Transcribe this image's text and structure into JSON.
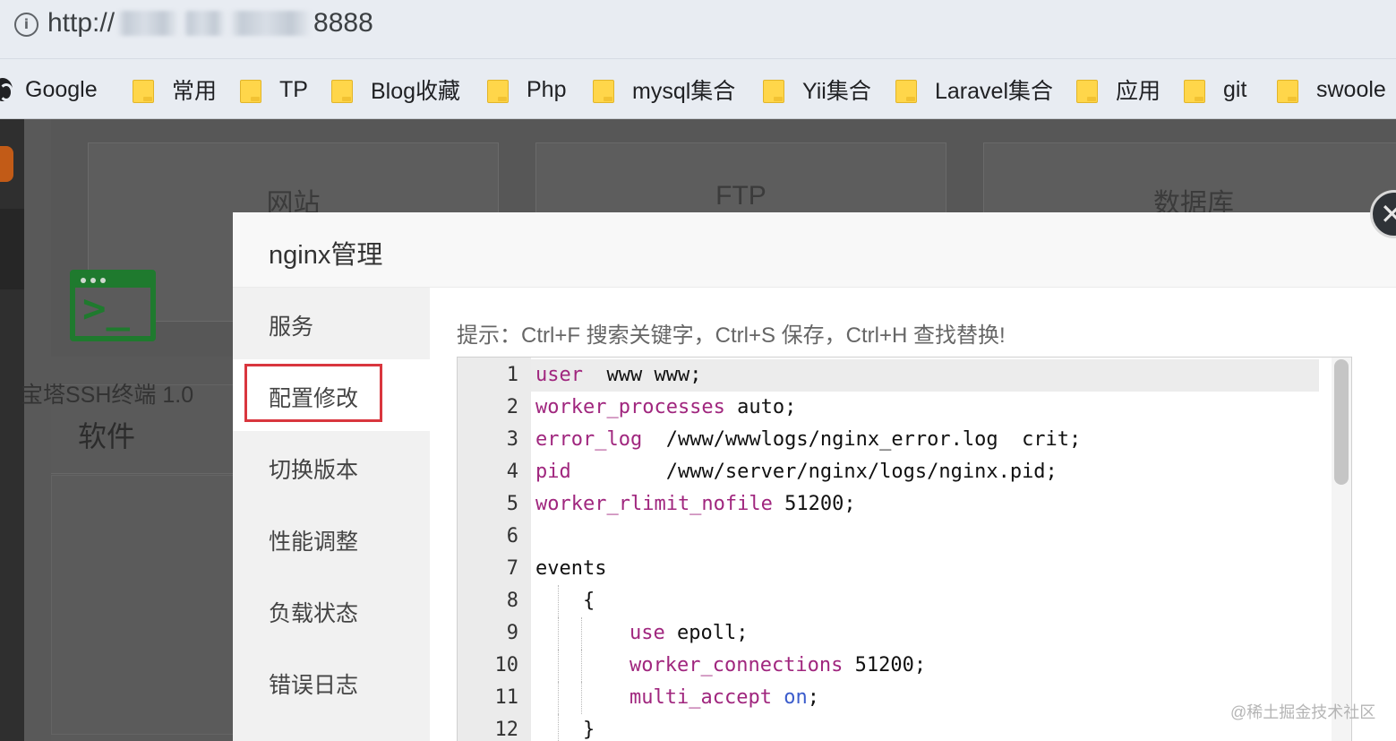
{
  "browser": {
    "url_prefix": "http://",
    "url_suffix": "8888",
    "bookmarks": [
      {
        "label": "Google",
        "icon": "google-icon"
      },
      {
        "label": "常用",
        "icon": "folder-icon"
      },
      {
        "label": "TP",
        "icon": "folder-icon"
      },
      {
        "label": "Blog收藏",
        "icon": "folder-icon"
      },
      {
        "label": "Php",
        "icon": "folder-icon"
      },
      {
        "label": "mysql集合",
        "icon": "folder-icon"
      },
      {
        "label": "Yii集合",
        "icon": "folder-icon"
      },
      {
        "label": "Laravel集合",
        "icon": "folder-icon"
      },
      {
        "label": "应用",
        "icon": "folder-icon"
      },
      {
        "label": "git",
        "icon": "folder-icon"
      },
      {
        "label": "swoole",
        "icon": "folder-icon"
      }
    ]
  },
  "background": {
    "stats": [
      "网站",
      "FTP",
      "数据库"
    ],
    "software_title": "软件",
    "ssh_label": "宝塔SSH终端 1.0"
  },
  "modal": {
    "title": "nginx管理",
    "nav": [
      "服务",
      "配置修改",
      "切换版本",
      "性能调整",
      "负载状态",
      "错误日志"
    ],
    "active_nav": "配置修改",
    "hint": "提示：Ctrl+F 搜索关键字，Ctrl+S 保存，Ctrl+H 查找替换!",
    "code_lines": [
      {
        "n": "1",
        "key": "user",
        "rest": "  www www;"
      },
      {
        "n": "2",
        "key": "worker_processes",
        "rest": " auto;"
      },
      {
        "n": "3",
        "key": "error_log",
        "rest": "  /www/wwwlogs/nginx_error.log  crit;"
      },
      {
        "n": "4",
        "key": "pid",
        "rest": "        /www/server/nginx/logs/nginx.pid;"
      },
      {
        "n": "5",
        "key": "worker_rlimit_nofile",
        "rest": " 51200;"
      },
      {
        "n": "6",
        "key": "",
        "rest": ""
      },
      {
        "n": "7",
        "key": "",
        "rest": "events"
      },
      {
        "n": "8",
        "key": "",
        "rest": "    {"
      },
      {
        "n": "9",
        "key": "use",
        "rest": " epoll;"
      },
      {
        "n": "10",
        "key": "worker_connections",
        "rest": " 51200;"
      },
      {
        "n": "11",
        "key": "multi_accept",
        "rest": " ",
        "value": "on",
        "tail": ";"
      },
      {
        "n": "12",
        "key": "",
        "rest": "    }"
      }
    ]
  },
  "watermark": "@稀土掘金技术社区",
  "colors": {
    "keyword": "#a0267e",
    "value_keyword": "#3b5ccc",
    "highlight_border": "#d9363e",
    "terminal_green": "#1f7a2e",
    "bookmark_folder": "#ffd64a"
  }
}
